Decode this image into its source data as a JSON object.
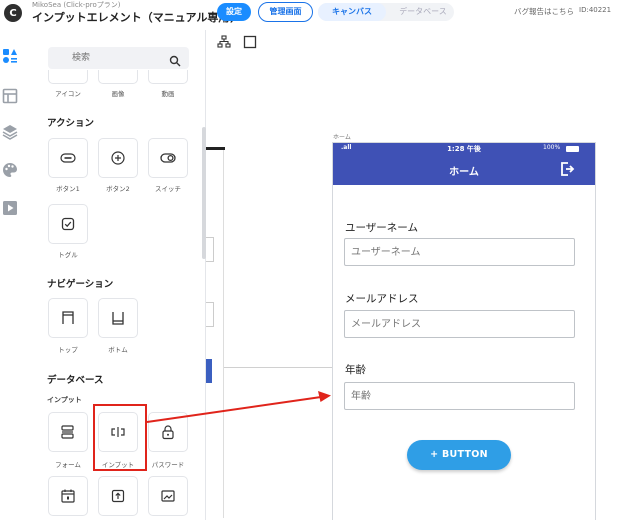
{
  "header": {
    "plan": "MikoSea (Click-proプラン)",
    "project_name": "インプットエレメント（マニュアル専用)",
    "settings_label": "設定",
    "admin_label": "管理画面",
    "canvas_label": "キャンバス",
    "database_label": "データベース",
    "bug_report": "バグ報告はこちら",
    "app_id": "ID:40221"
  },
  "rail": {
    "icons": [
      "components-icon",
      "layout-icon",
      "layers-icon",
      "palette-icon",
      "preview-icon"
    ]
  },
  "panel": {
    "search_placeholder": "検索",
    "top_row": [
      "アイコン",
      "画像",
      "動画"
    ],
    "actions_title": "アクション",
    "actions": [
      "ボタン1",
      "ボタン2",
      "スイッチ",
      "トグル"
    ],
    "navigation_title": "ナビゲーション",
    "navigation": [
      "トップ",
      "ボトム"
    ],
    "database_title": "データベース",
    "input_subtitle": "インプット",
    "inputs": [
      "フォーム",
      "インプット",
      "パスワード"
    ]
  },
  "canvas": {
    "frame_label": "ホーム",
    "status": {
      "signal": ".all",
      "time": "1:28 午後",
      "battery": "100%"
    },
    "appbar_title": "ホーム",
    "fields": [
      {
        "label": "ユーザーネーム",
        "placeholder": "ユーザーネーム"
      },
      {
        "label": "メールアドレス",
        "placeholder": "メールアドレス"
      },
      {
        "label": "年齢",
        "placeholder": "年齢"
      }
    ],
    "button_label": "+  BUTTON"
  },
  "colors": {
    "primary": "#1a8cff",
    "appbar": "#3f51b5",
    "button": "#2f9ee6",
    "highlight": "#e0241b"
  }
}
